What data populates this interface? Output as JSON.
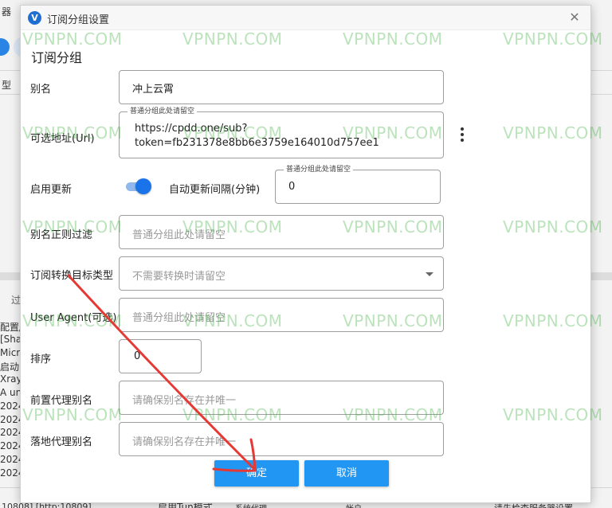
{
  "background": {
    "top_left_text": "器",
    "left_tab_text": "型",
    "left_panel_tab": "过",
    "log_lines": [
      "配置/",
      "[Sha",
      "Micr",
      "启动",
      "Xray",
      "A un",
      "2024",
      "2024",
      "2024",
      "2024",
      "2024",
      "2024"
    ],
    "status_bar": {
      "port": "10808] [http:10809]",
      "tun_mode": "启用Tun模式",
      "proxy": "系统代理",
      "item": "帐户",
      "right": "请先检查服务器设置"
    }
  },
  "dialog": {
    "title": "订阅分组设置",
    "heading": "订阅分组",
    "fields": {
      "alias": {
        "label": "别名",
        "value": "冲上云霄"
      },
      "url": {
        "label": "可选地址(Url)",
        "legend": "普通分组此处请留空",
        "value_line1": "https://cpdd.one/sub?",
        "value_line2": "token=fb231378e8bb6e3759e164010d757ee1"
      },
      "enable_update": {
        "label": "启用更新",
        "enabled": true
      },
      "interval": {
        "label": "自动更新间隔(分钟)",
        "legend": "普通分组此处请留空",
        "value": "0"
      },
      "alias_filter": {
        "label": "别名正则过滤",
        "placeholder": "普通分组此处请留空"
      },
      "convert_target": {
        "label": "订阅转换目标类型",
        "placeholder": "不需要转换时请留空"
      },
      "user_agent": {
        "label": "User Agent(可选)",
        "placeholder": "普通分组此处请留空"
      },
      "sort": {
        "label": "排序",
        "value": "0"
      },
      "prev_proxy": {
        "label": "前置代理别名",
        "placeholder": "请确保别名存在并唯一"
      },
      "landing_proxy": {
        "label": "落地代理别名",
        "placeholder": "请确保别名存在并唯一"
      }
    },
    "buttons": {
      "ok": "确定",
      "cancel": "取消"
    }
  },
  "watermark": "VPNPN.COM",
  "colors": {
    "accent": "#2196f3",
    "toggle": "#1a73e8",
    "annotation_arrow": "#e53935",
    "watermark": "#3caf3c"
  }
}
